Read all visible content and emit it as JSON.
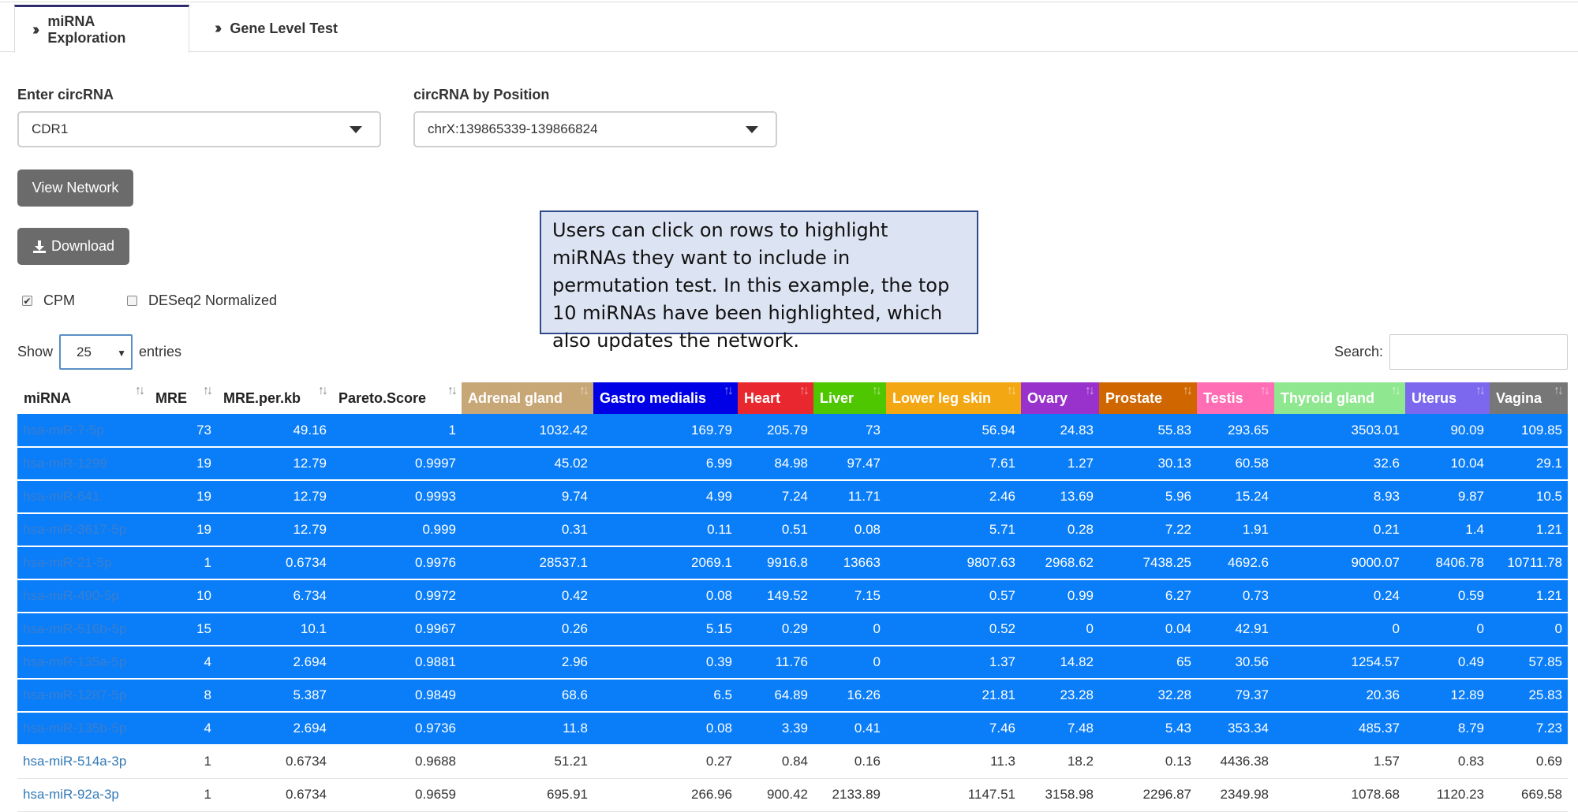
{
  "tabs": [
    {
      "label": "miRNA Exploration",
      "active": true
    },
    {
      "label": "Gene Level Test",
      "active": false
    }
  ],
  "circrna_input": {
    "label": "Enter circRNA",
    "value": "CDR1"
  },
  "position_input": {
    "label": "circRNA by Position",
    "value": "chrX:139865339-139866824"
  },
  "buttons": {
    "view_network": "View Network",
    "download": "Download"
  },
  "checkboxes": [
    {
      "label": "CPM",
      "checked": true
    },
    {
      "label": "DESeq2 Normalized",
      "checked": false
    }
  ],
  "annotation": "Users can click on rows to highlight miRNAs they want to include in permutation test. In this example, the top 10 miRNAs have been highlighted, which also updates the network.",
  "length_control": {
    "show": "Show",
    "value": "25",
    "entries": "entries"
  },
  "search": {
    "label": "Search:",
    "value": ""
  },
  "table": {
    "columns": [
      {
        "label": "miRNA",
        "color": ""
      },
      {
        "label": "MRE",
        "color": ""
      },
      {
        "label": "MRE.per.kb",
        "color": ""
      },
      {
        "label": "Pareto.Score",
        "color": ""
      },
      {
        "label": "Adrenal gland",
        "color": "#c8a777"
      },
      {
        "label": "Gastro medialis",
        "color": "#0000e6"
      },
      {
        "label": "Heart",
        "color": "#e8272e"
      },
      {
        "label": "Liver",
        "color": "#4ec600"
      },
      {
        "label": "Lower leg skin",
        "color": "#f3a712"
      },
      {
        "label": "Ovary",
        "color": "#9932cc"
      },
      {
        "label": "Prostate",
        "color": "#d06600"
      },
      {
        "label": "Testis",
        "color": "#ff6eb4"
      },
      {
        "label": "Thyroid gland",
        "color": "#8fe88f"
      },
      {
        "label": "Uterus",
        "color": "#7b68ee"
      },
      {
        "label": "Vagina",
        "color": "#777777"
      }
    ],
    "rows": [
      {
        "selected": true,
        "cells": [
          "hsa-miR-7-5p",
          "73",
          "49.16",
          "1",
          "1032.42",
          "169.79",
          "205.79",
          "73",
          "56.94",
          "24.83",
          "55.83",
          "293.65",
          "3503.01",
          "90.09",
          "109.85"
        ]
      },
      {
        "selected": true,
        "cells": [
          "hsa-miR-1299",
          "19",
          "12.79",
          "0.9997",
          "45.02",
          "6.99",
          "84.98",
          "97.47",
          "7.61",
          "1.27",
          "30.13",
          "60.58",
          "32.6",
          "10.04",
          "29.1"
        ]
      },
      {
        "selected": true,
        "cells": [
          "hsa-miR-641",
          "19",
          "12.79",
          "0.9993",
          "9.74",
          "4.99",
          "7.24",
          "11.71",
          "2.46",
          "13.69",
          "5.96",
          "15.24",
          "8.93",
          "9.87",
          "10.5"
        ]
      },
      {
        "selected": true,
        "cells": [
          "hsa-miR-3617-5p",
          "19",
          "12.79",
          "0.999",
          "0.31",
          "0.11",
          "0.51",
          "0.08",
          "5.71",
          "0.28",
          "7.22",
          "1.91",
          "0.21",
          "1.4",
          "1.21"
        ]
      },
      {
        "selected": true,
        "cells": [
          "hsa-miR-21-5p",
          "1",
          "0.6734",
          "0.9976",
          "28537.1",
          "2069.1",
          "9916.8",
          "13663",
          "9807.63",
          "2968.62",
          "7438.25",
          "4692.6",
          "9000.07",
          "8406.78",
          "10711.78"
        ]
      },
      {
        "selected": true,
        "cells": [
          "hsa-miR-490-5p",
          "10",
          "6.734",
          "0.9972",
          "0.42",
          "0.08",
          "149.52",
          "7.15",
          "0.57",
          "0.99",
          "6.27",
          "0.73",
          "0.24",
          "0.59",
          "1.21"
        ]
      },
      {
        "selected": true,
        "cells": [
          "hsa-miR-516b-5p",
          "15",
          "10.1",
          "0.9967",
          "0.26",
          "5.15",
          "0.29",
          "0",
          "0.52",
          "0",
          "0.04",
          "42.91",
          "0",
          "0",
          "0"
        ]
      },
      {
        "selected": true,
        "cells": [
          "hsa-miR-135a-5p",
          "4",
          "2.694",
          "0.9881",
          "2.96",
          "0.39",
          "11.76",
          "0",
          "1.37",
          "14.82",
          "65",
          "30.56",
          "1254.57",
          "0.49",
          "57.85"
        ]
      },
      {
        "selected": true,
        "cells": [
          "hsa-miR-1287-5p",
          "8",
          "5.387",
          "0.9849",
          "68.6",
          "6.5",
          "64.89",
          "16.26",
          "21.81",
          "23.28",
          "32.28",
          "79.37",
          "20.36",
          "12.89",
          "25.83"
        ]
      },
      {
        "selected": true,
        "cells": [
          "hsa-miR-135b-5p",
          "4",
          "2.694",
          "0.9736",
          "11.8",
          "0.08",
          "3.39",
          "0.41",
          "7.46",
          "7.48",
          "5.43",
          "353.34",
          "485.37",
          "8.79",
          "7.23"
        ]
      },
      {
        "selected": false,
        "cells": [
          "hsa-miR-514a-3p",
          "1",
          "0.6734",
          "0.9688",
          "51.21",
          "0.27",
          "0.84",
          "0.16",
          "11.3",
          "18.2",
          "0.13",
          "4436.38",
          "1.57",
          "0.83",
          "0.69"
        ]
      },
      {
        "selected": false,
        "cells": [
          "hsa-miR-92a-3p",
          "1",
          "0.6734",
          "0.9659",
          "695.91",
          "266.96",
          "900.42",
          "2133.89",
          "1147.51",
          "3158.98",
          "2296.87",
          "2349.98",
          "1078.68",
          "1120.23",
          "669.58"
        ]
      }
    ]
  }
}
